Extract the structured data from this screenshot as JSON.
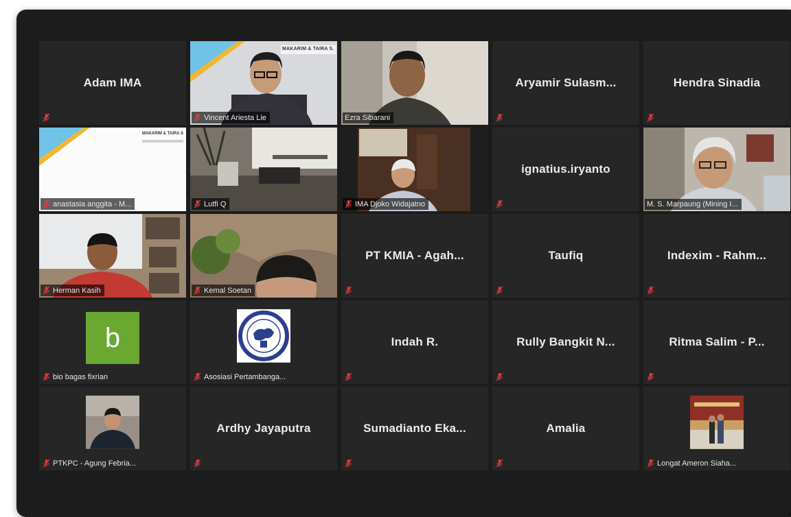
{
  "participants": [
    {
      "name": "Adam IMA"
    },
    {
      "name": "Vincent Ariesta Lie",
      "banner": "MAKARIM & TAIRA S."
    },
    {
      "name": "Ezra Sibarani"
    },
    {
      "name": "Aryamir  Sulasm..."
    },
    {
      "name": "Hendra Sinadia"
    },
    {
      "name": "anastasia anggita - M...",
      "banner": "MAKARIM & TAIRA S"
    },
    {
      "name": "Lutfi Q"
    },
    {
      "name": "IMA Djoko Widajatno"
    },
    {
      "name": "ignatius.iryanto"
    },
    {
      "name": "M. S. Marpaung (Mining I..."
    },
    {
      "name": "Herman Kasih"
    },
    {
      "name": "Kemal Soetan"
    },
    {
      "name": "PT KMIA - Agah..."
    },
    {
      "name": "Taufiq"
    },
    {
      "name": "Indexim - Rahm..."
    },
    {
      "name": "bio bagas fixrian",
      "avatar_letter": "b"
    },
    {
      "name": "Asosiasi Pertambanga..."
    },
    {
      "name": "Indah R."
    },
    {
      "name": "Rully Bangkit N..."
    },
    {
      "name": "Ritma Salim - P..."
    },
    {
      "name": "PTKPC - Agung Febria..."
    },
    {
      "name": "Ardhy Jayaputra"
    },
    {
      "name": "Sumadianto Eka..."
    },
    {
      "name": "Amalia"
    },
    {
      "name": "Longat Ameron Siaha..."
    }
  ],
  "colors": {
    "window_bg": "#1c1c1c",
    "tile_bg": "#262626",
    "active_speaker": "#c5d84f",
    "muted_mic": "#e0393e",
    "avatar_green": "#6aa832"
  },
  "icons": {
    "muted": "mic-muted-icon"
  }
}
